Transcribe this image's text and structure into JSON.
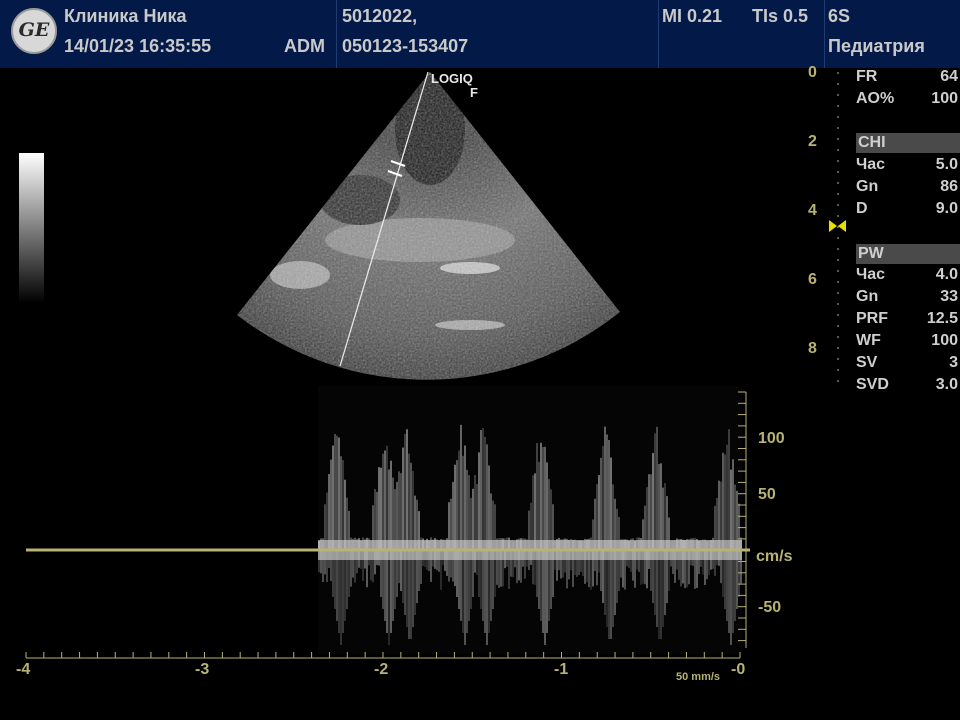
{
  "header": {
    "logo_text": "GE",
    "clinic": "Клиника Ника",
    "datetime": "14/01/23 16:35:55",
    "operator": "ADM",
    "patient_id": "5012022,",
    "exam_id": "050123-153407",
    "mi": "MI 0.21",
    "tis": "TIs 0.5",
    "probe": "6S",
    "preset": "Педиатрия"
  },
  "image": {
    "system_label": "LOGIQ",
    "focus_label": "F",
    "depth_marks": [
      "0",
      "2",
      "4",
      "6",
      "8"
    ]
  },
  "params": {
    "top": [
      {
        "name": "FR",
        "value": "64"
      },
      {
        "name": "AO%",
        "value": "100"
      }
    ],
    "chi_title": "CHI",
    "chi": [
      {
        "name": "Час",
        "value": "5.0"
      },
      {
        "name": "Gn",
        "value": "86"
      },
      {
        "name": "D",
        "value": "9.0"
      }
    ],
    "pw_title": "PW",
    "pw": [
      {
        "name": "Час",
        "value": "4.0"
      },
      {
        "name": "Gn",
        "value": "33"
      },
      {
        "name": "PRF",
        "value": "12.5"
      },
      {
        "name": "WF",
        "value": "100"
      },
      {
        "name": "SV",
        "value": "3"
      },
      {
        "name": "SVD",
        "value": "3.0"
      }
    ]
  },
  "doppler": {
    "velocity_labels": [
      "100",
      "50",
      "cm/s",
      "-50"
    ],
    "time_labels": [
      "-4",
      "-3",
      "-2",
      "-1",
      "-0"
    ],
    "sweep_speed": "50 mm/s"
  },
  "colors": {
    "header_bg": "#031a49",
    "accent": "#b9b275",
    "baseline": "#b9b275"
  }
}
